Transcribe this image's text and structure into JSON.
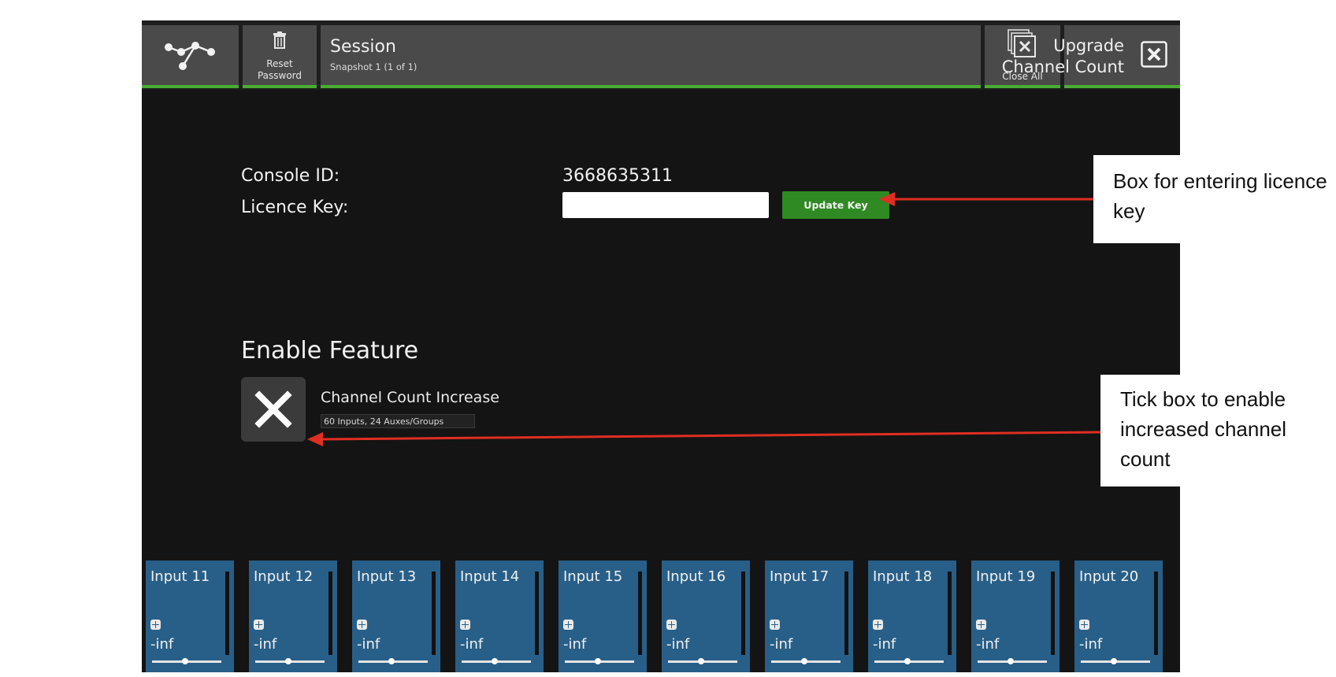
{
  "topbar": {
    "logo_icon": "signal-flow-icon",
    "reset": {
      "icon": "trash-icon",
      "label": "Reset\nPassword"
    },
    "session": {
      "title": "Session",
      "subtitle": "Snapshot 1 (1 of 1)"
    },
    "close_all": {
      "icon": "close-all-windows-icon",
      "label": "Close All"
    },
    "upgrade": {
      "title_line1": "Upgrade",
      "title_line2": "Channel Count",
      "close_icon": "close-icon"
    },
    "accent_color": "#49ad32"
  },
  "licence": {
    "console_id_label": "Console ID:",
    "console_id_value": "3668635311",
    "licence_key_label": "Licence Key:",
    "licence_key_value": "",
    "update_button": "Update Key"
  },
  "feature": {
    "heading": "Enable Feature",
    "name": "Channel Count Increase",
    "description": "60 Inputs, 24 Auxes/Groups",
    "enabled": false,
    "checkbox_icon": "x-mark-icon"
  },
  "channels": [
    {
      "name": "Input 11",
      "level": "-inf"
    },
    {
      "name": "Input 12",
      "level": "-inf"
    },
    {
      "name": "Input 13",
      "level": "-inf"
    },
    {
      "name": "Input 14",
      "level": "-inf"
    },
    {
      "name": "Input 15",
      "level": "-inf"
    },
    {
      "name": "Input 16",
      "level": "-inf"
    },
    {
      "name": "Input 17",
      "level": "-inf"
    },
    {
      "name": "Input 18",
      "level": "-inf"
    },
    {
      "name": "Input 19",
      "level": "-inf"
    },
    {
      "name": "Input 20",
      "level": "-inf"
    }
  ],
  "annotations": {
    "licence_box": "Box for entering licence key",
    "tick_box": "Tick box to enable increased channel count",
    "arrow_color": "#e02e22"
  }
}
